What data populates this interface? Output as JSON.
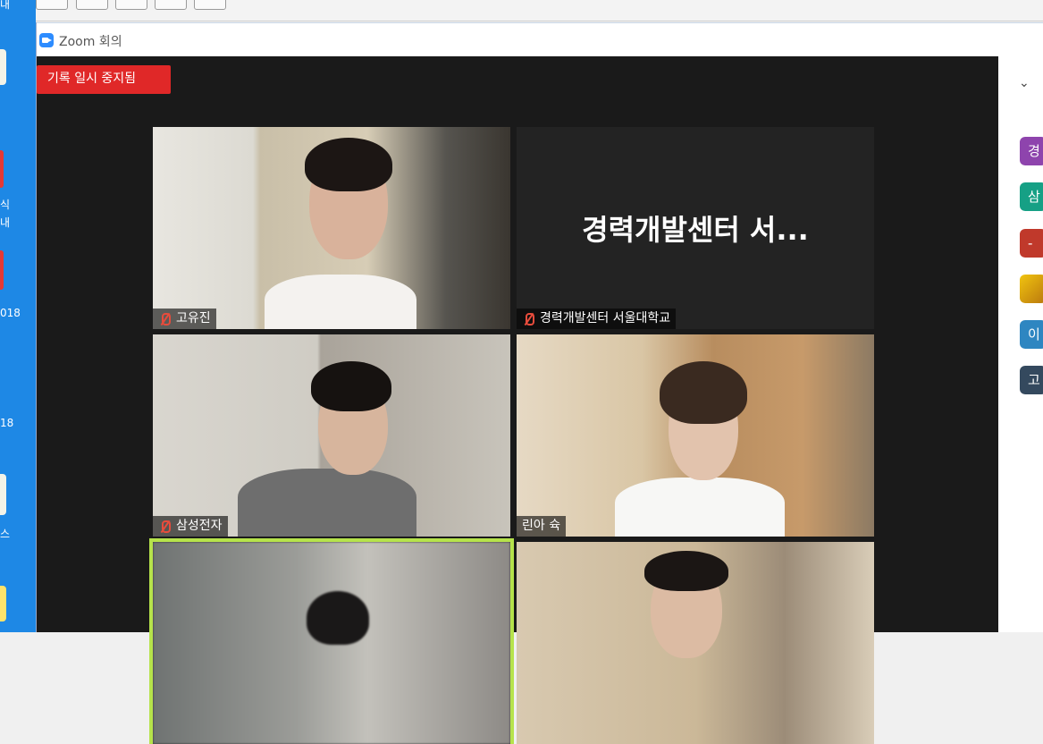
{
  "desktop": {
    "fragments": [
      "내",
      "식",
      "내",
      "018",
      "18",
      "스"
    ]
  },
  "window": {
    "title": "Zoom 회의"
  },
  "recording": {
    "label": "기록 일시 중지됨"
  },
  "participants": [
    {
      "name": "고유진",
      "muted": true,
      "video": true,
      "display_text": ""
    },
    {
      "name": "경력개발센터 서울대학교",
      "muted": true,
      "video": false,
      "display_text": "경력개발센터 서..."
    },
    {
      "name": "삼성전자",
      "muted": true,
      "video": true,
      "display_text": ""
    },
    {
      "name": "린아 슉",
      "muted": false,
      "video": true,
      "display_text": ""
    },
    {
      "name": "",
      "muted": false,
      "video": true,
      "active_speaker": true,
      "display_text": ""
    },
    {
      "name": "",
      "muted": false,
      "video": true,
      "display_text": ""
    }
  ],
  "sidebar": {
    "avatars": [
      {
        "initial": "경",
        "color": "#8e44ad"
      },
      {
        "initial": "삼",
        "color": "#16a085"
      },
      {
        "initial": "-",
        "color": "#c0392b"
      },
      {
        "initial": "",
        "color": "#d4a017",
        "image": true
      },
      {
        "initial": "이",
        "color": "#2e86c1"
      },
      {
        "initial": "고",
        "color": "#34495e"
      }
    ]
  },
  "colors": {
    "recording_badge": "#e02828",
    "active_speaker_border": "#b6e34b",
    "muted_icon": "#e74c3c"
  }
}
